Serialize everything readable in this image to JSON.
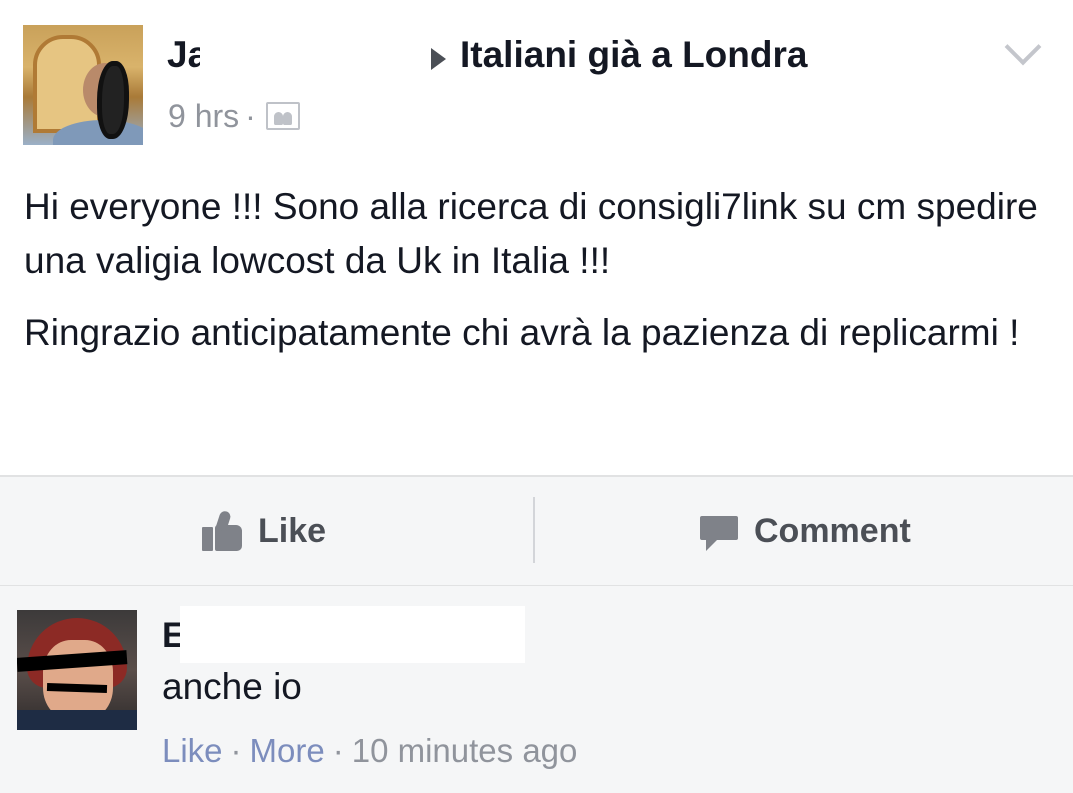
{
  "post": {
    "author_initial": "Ja",
    "group_name": "Italiani già a Londra",
    "time": "9 hrs",
    "separator": "·",
    "privacy_icon": "group-icon",
    "paragraphs": [
      "Hi everyone !!! Sono alla ricerca di consigli7link su cm spedire una valigia lowcost da Uk in Italia !!!",
      "Ringrazio anticipatamente chi avrà la pazienza di replicarmi !"
    ]
  },
  "actions": {
    "like_label": "Like",
    "comment_label": "Comment"
  },
  "comment": {
    "author_initial": "E",
    "text": "anche io",
    "like_label": "Like",
    "more_label": "More",
    "separator": "·",
    "time": "10 minutes ago"
  },
  "colors": {
    "text": "#141823",
    "meta": "#90949c",
    "link": "#7c8dbd",
    "action_bar": "#f5f6f7"
  }
}
